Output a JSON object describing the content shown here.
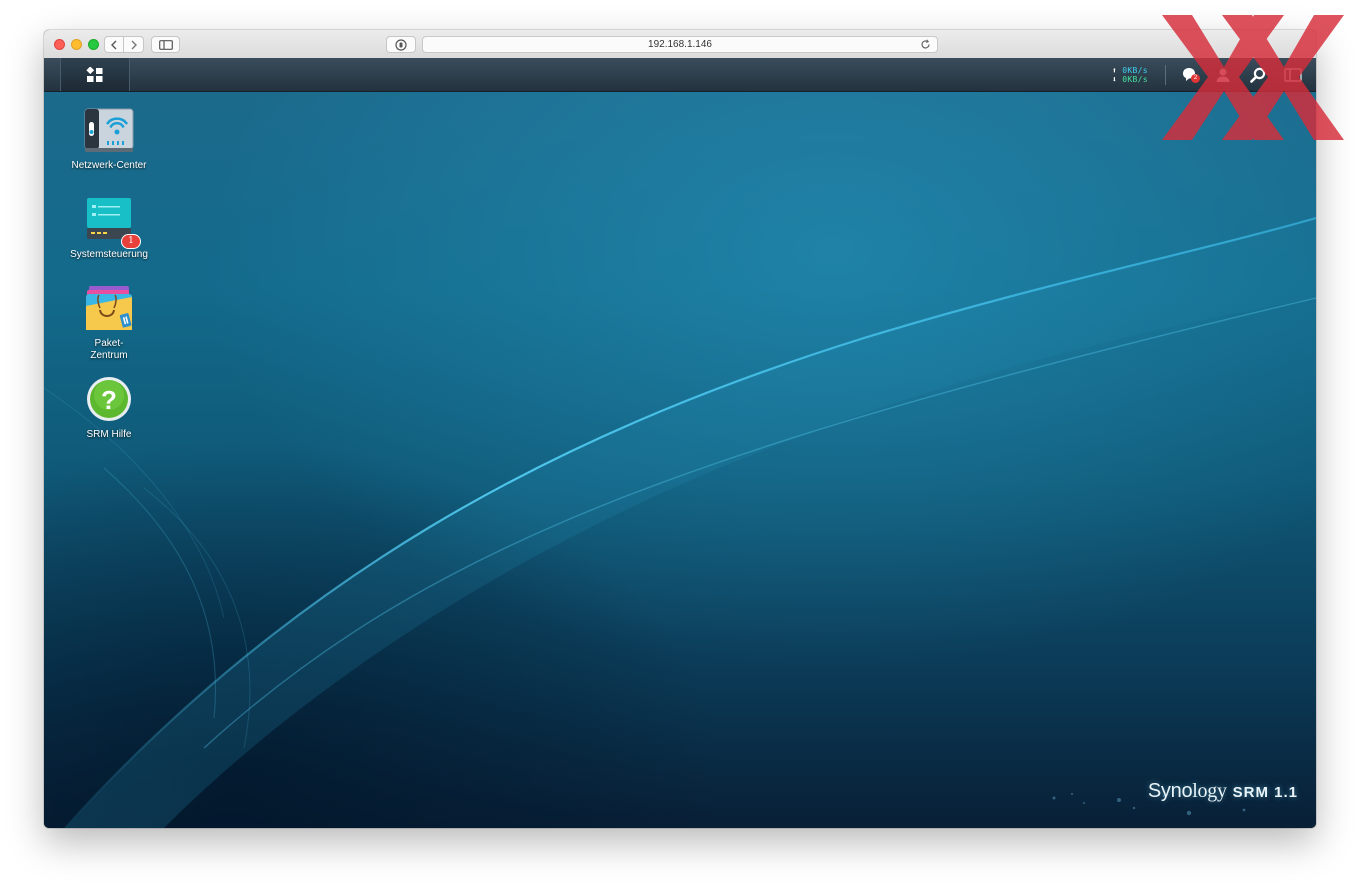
{
  "browser": {
    "address": "192.168.1.146"
  },
  "taskbar": {
    "upload_speed": "0KB/s",
    "download_speed": "0KB/s",
    "notification_count": "2",
    "icons": [
      "main-menu-icon",
      "notification-icon",
      "user-icon",
      "search-icon",
      "widgets-icon"
    ]
  },
  "desktop": {
    "icons": [
      {
        "label": "Netzwerk-Center"
      },
      {
        "label": "Systemsteuerung",
        "badge": "1"
      },
      {
        "label_line1": "Paket-",
        "label_line2": "Zentrum"
      },
      {
        "label": "SRM Hilfe"
      }
    ]
  },
  "brand": {
    "synology": "Syno",
    "logy": "logy",
    "product": "SRM 1.1"
  },
  "colors": {
    "accent": "#1aa6d4",
    "badge": "#e8403a",
    "watermark": "#d62d3a"
  }
}
